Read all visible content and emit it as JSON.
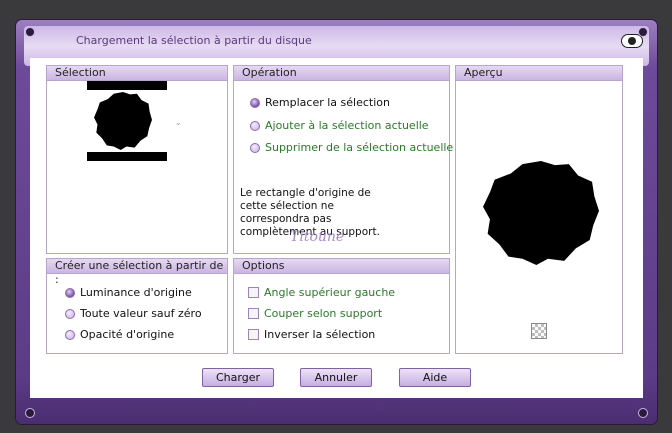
{
  "window": {
    "title": "Chargement la sélection à partir du disque"
  },
  "panels": {
    "selection": {
      "title": "Sélection"
    },
    "operation": {
      "title": "Opération",
      "options": [
        {
          "label": "Remplacer la sélection",
          "selected": true
        },
        {
          "label": "Ajouter à la sélection actuelle",
          "selected": false
        },
        {
          "label": "Supprimer de la sélection actuelle",
          "selected": false
        }
      ],
      "note": "Le rectangle d'origine de cette sélection ne correspondra pas complètement au support.",
      "signature": "Titoune"
    },
    "preview": {
      "title": "Aperçu"
    },
    "create": {
      "title": "Créer une sélection à partir de :",
      "options": [
        {
          "label": "Luminance d'origine",
          "selected": true
        },
        {
          "label": "Toute valeur sauf zéro",
          "selected": false
        },
        {
          "label": "Opacité d'origine",
          "selected": false
        }
      ]
    },
    "options": {
      "title": "Options",
      "checks": [
        {
          "label": "Angle supérieur gauche",
          "checked": false
        },
        {
          "label": "Couper selon support",
          "checked": false
        },
        {
          "label": "Inverser la sélection",
          "checked": false
        }
      ]
    }
  },
  "buttons": {
    "load": "Charger",
    "cancel": "Annuler",
    "help": "Aide"
  },
  "colors": {
    "accent": "#7a53a6",
    "option_text_green": "#2a7a2a",
    "frame": "#5c3c87"
  }
}
